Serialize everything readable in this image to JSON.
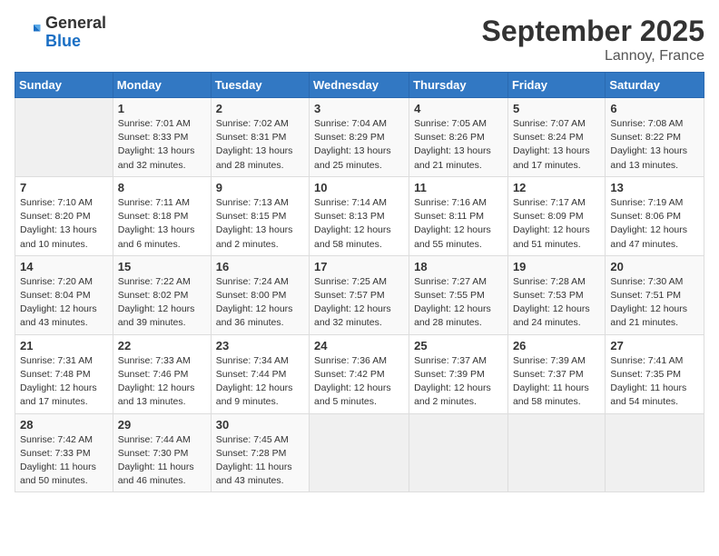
{
  "header": {
    "logo_general": "General",
    "logo_blue": "Blue",
    "title": "September 2025",
    "subtitle": "Lannoy, France"
  },
  "days_of_week": [
    "Sunday",
    "Monday",
    "Tuesday",
    "Wednesday",
    "Thursday",
    "Friday",
    "Saturday"
  ],
  "weeks": [
    [
      {
        "day": "",
        "sunrise": "",
        "sunset": "",
        "daylight": ""
      },
      {
        "day": "1",
        "sunrise": "Sunrise: 7:01 AM",
        "sunset": "Sunset: 8:33 PM",
        "daylight": "Daylight: 13 hours and 32 minutes."
      },
      {
        "day": "2",
        "sunrise": "Sunrise: 7:02 AM",
        "sunset": "Sunset: 8:31 PM",
        "daylight": "Daylight: 13 hours and 28 minutes."
      },
      {
        "day": "3",
        "sunrise": "Sunrise: 7:04 AM",
        "sunset": "Sunset: 8:29 PM",
        "daylight": "Daylight: 13 hours and 25 minutes."
      },
      {
        "day": "4",
        "sunrise": "Sunrise: 7:05 AM",
        "sunset": "Sunset: 8:26 PM",
        "daylight": "Daylight: 13 hours and 21 minutes."
      },
      {
        "day": "5",
        "sunrise": "Sunrise: 7:07 AM",
        "sunset": "Sunset: 8:24 PM",
        "daylight": "Daylight: 13 hours and 17 minutes."
      },
      {
        "day": "6",
        "sunrise": "Sunrise: 7:08 AM",
        "sunset": "Sunset: 8:22 PM",
        "daylight": "Daylight: 13 hours and 13 minutes."
      }
    ],
    [
      {
        "day": "7",
        "sunrise": "Sunrise: 7:10 AM",
        "sunset": "Sunset: 8:20 PM",
        "daylight": "Daylight: 13 hours and 10 minutes."
      },
      {
        "day": "8",
        "sunrise": "Sunrise: 7:11 AM",
        "sunset": "Sunset: 8:18 PM",
        "daylight": "Daylight: 13 hours and 6 minutes."
      },
      {
        "day": "9",
        "sunrise": "Sunrise: 7:13 AM",
        "sunset": "Sunset: 8:15 PM",
        "daylight": "Daylight: 13 hours and 2 minutes."
      },
      {
        "day": "10",
        "sunrise": "Sunrise: 7:14 AM",
        "sunset": "Sunset: 8:13 PM",
        "daylight": "Daylight: 12 hours and 58 minutes."
      },
      {
        "day": "11",
        "sunrise": "Sunrise: 7:16 AM",
        "sunset": "Sunset: 8:11 PM",
        "daylight": "Daylight: 12 hours and 55 minutes."
      },
      {
        "day": "12",
        "sunrise": "Sunrise: 7:17 AM",
        "sunset": "Sunset: 8:09 PM",
        "daylight": "Daylight: 12 hours and 51 minutes."
      },
      {
        "day": "13",
        "sunrise": "Sunrise: 7:19 AM",
        "sunset": "Sunset: 8:06 PM",
        "daylight": "Daylight: 12 hours and 47 minutes."
      }
    ],
    [
      {
        "day": "14",
        "sunrise": "Sunrise: 7:20 AM",
        "sunset": "Sunset: 8:04 PM",
        "daylight": "Daylight: 12 hours and 43 minutes."
      },
      {
        "day": "15",
        "sunrise": "Sunrise: 7:22 AM",
        "sunset": "Sunset: 8:02 PM",
        "daylight": "Daylight: 12 hours and 39 minutes."
      },
      {
        "day": "16",
        "sunrise": "Sunrise: 7:24 AM",
        "sunset": "Sunset: 8:00 PM",
        "daylight": "Daylight: 12 hours and 36 minutes."
      },
      {
        "day": "17",
        "sunrise": "Sunrise: 7:25 AM",
        "sunset": "Sunset: 7:57 PM",
        "daylight": "Daylight: 12 hours and 32 minutes."
      },
      {
        "day": "18",
        "sunrise": "Sunrise: 7:27 AM",
        "sunset": "Sunset: 7:55 PM",
        "daylight": "Daylight: 12 hours and 28 minutes."
      },
      {
        "day": "19",
        "sunrise": "Sunrise: 7:28 AM",
        "sunset": "Sunset: 7:53 PM",
        "daylight": "Daylight: 12 hours and 24 minutes."
      },
      {
        "day": "20",
        "sunrise": "Sunrise: 7:30 AM",
        "sunset": "Sunset: 7:51 PM",
        "daylight": "Daylight: 12 hours and 21 minutes."
      }
    ],
    [
      {
        "day": "21",
        "sunrise": "Sunrise: 7:31 AM",
        "sunset": "Sunset: 7:48 PM",
        "daylight": "Daylight: 12 hours and 17 minutes."
      },
      {
        "day": "22",
        "sunrise": "Sunrise: 7:33 AM",
        "sunset": "Sunset: 7:46 PM",
        "daylight": "Daylight: 12 hours and 13 minutes."
      },
      {
        "day": "23",
        "sunrise": "Sunrise: 7:34 AM",
        "sunset": "Sunset: 7:44 PM",
        "daylight": "Daylight: 12 hours and 9 minutes."
      },
      {
        "day": "24",
        "sunrise": "Sunrise: 7:36 AM",
        "sunset": "Sunset: 7:42 PM",
        "daylight": "Daylight: 12 hours and 5 minutes."
      },
      {
        "day": "25",
        "sunrise": "Sunrise: 7:37 AM",
        "sunset": "Sunset: 7:39 PM",
        "daylight": "Daylight: 12 hours and 2 minutes."
      },
      {
        "day": "26",
        "sunrise": "Sunrise: 7:39 AM",
        "sunset": "Sunset: 7:37 PM",
        "daylight": "Daylight: 11 hours and 58 minutes."
      },
      {
        "day": "27",
        "sunrise": "Sunrise: 7:41 AM",
        "sunset": "Sunset: 7:35 PM",
        "daylight": "Daylight: 11 hours and 54 minutes."
      }
    ],
    [
      {
        "day": "28",
        "sunrise": "Sunrise: 7:42 AM",
        "sunset": "Sunset: 7:33 PM",
        "daylight": "Daylight: 11 hours and 50 minutes."
      },
      {
        "day": "29",
        "sunrise": "Sunrise: 7:44 AM",
        "sunset": "Sunset: 7:30 PM",
        "daylight": "Daylight: 11 hours and 46 minutes."
      },
      {
        "day": "30",
        "sunrise": "Sunrise: 7:45 AM",
        "sunset": "Sunset: 7:28 PM",
        "daylight": "Daylight: 11 hours and 43 minutes."
      },
      {
        "day": "",
        "sunrise": "",
        "sunset": "",
        "daylight": ""
      },
      {
        "day": "",
        "sunrise": "",
        "sunset": "",
        "daylight": ""
      },
      {
        "day": "",
        "sunrise": "",
        "sunset": "",
        "daylight": ""
      },
      {
        "day": "",
        "sunrise": "",
        "sunset": "",
        "daylight": ""
      }
    ]
  ]
}
